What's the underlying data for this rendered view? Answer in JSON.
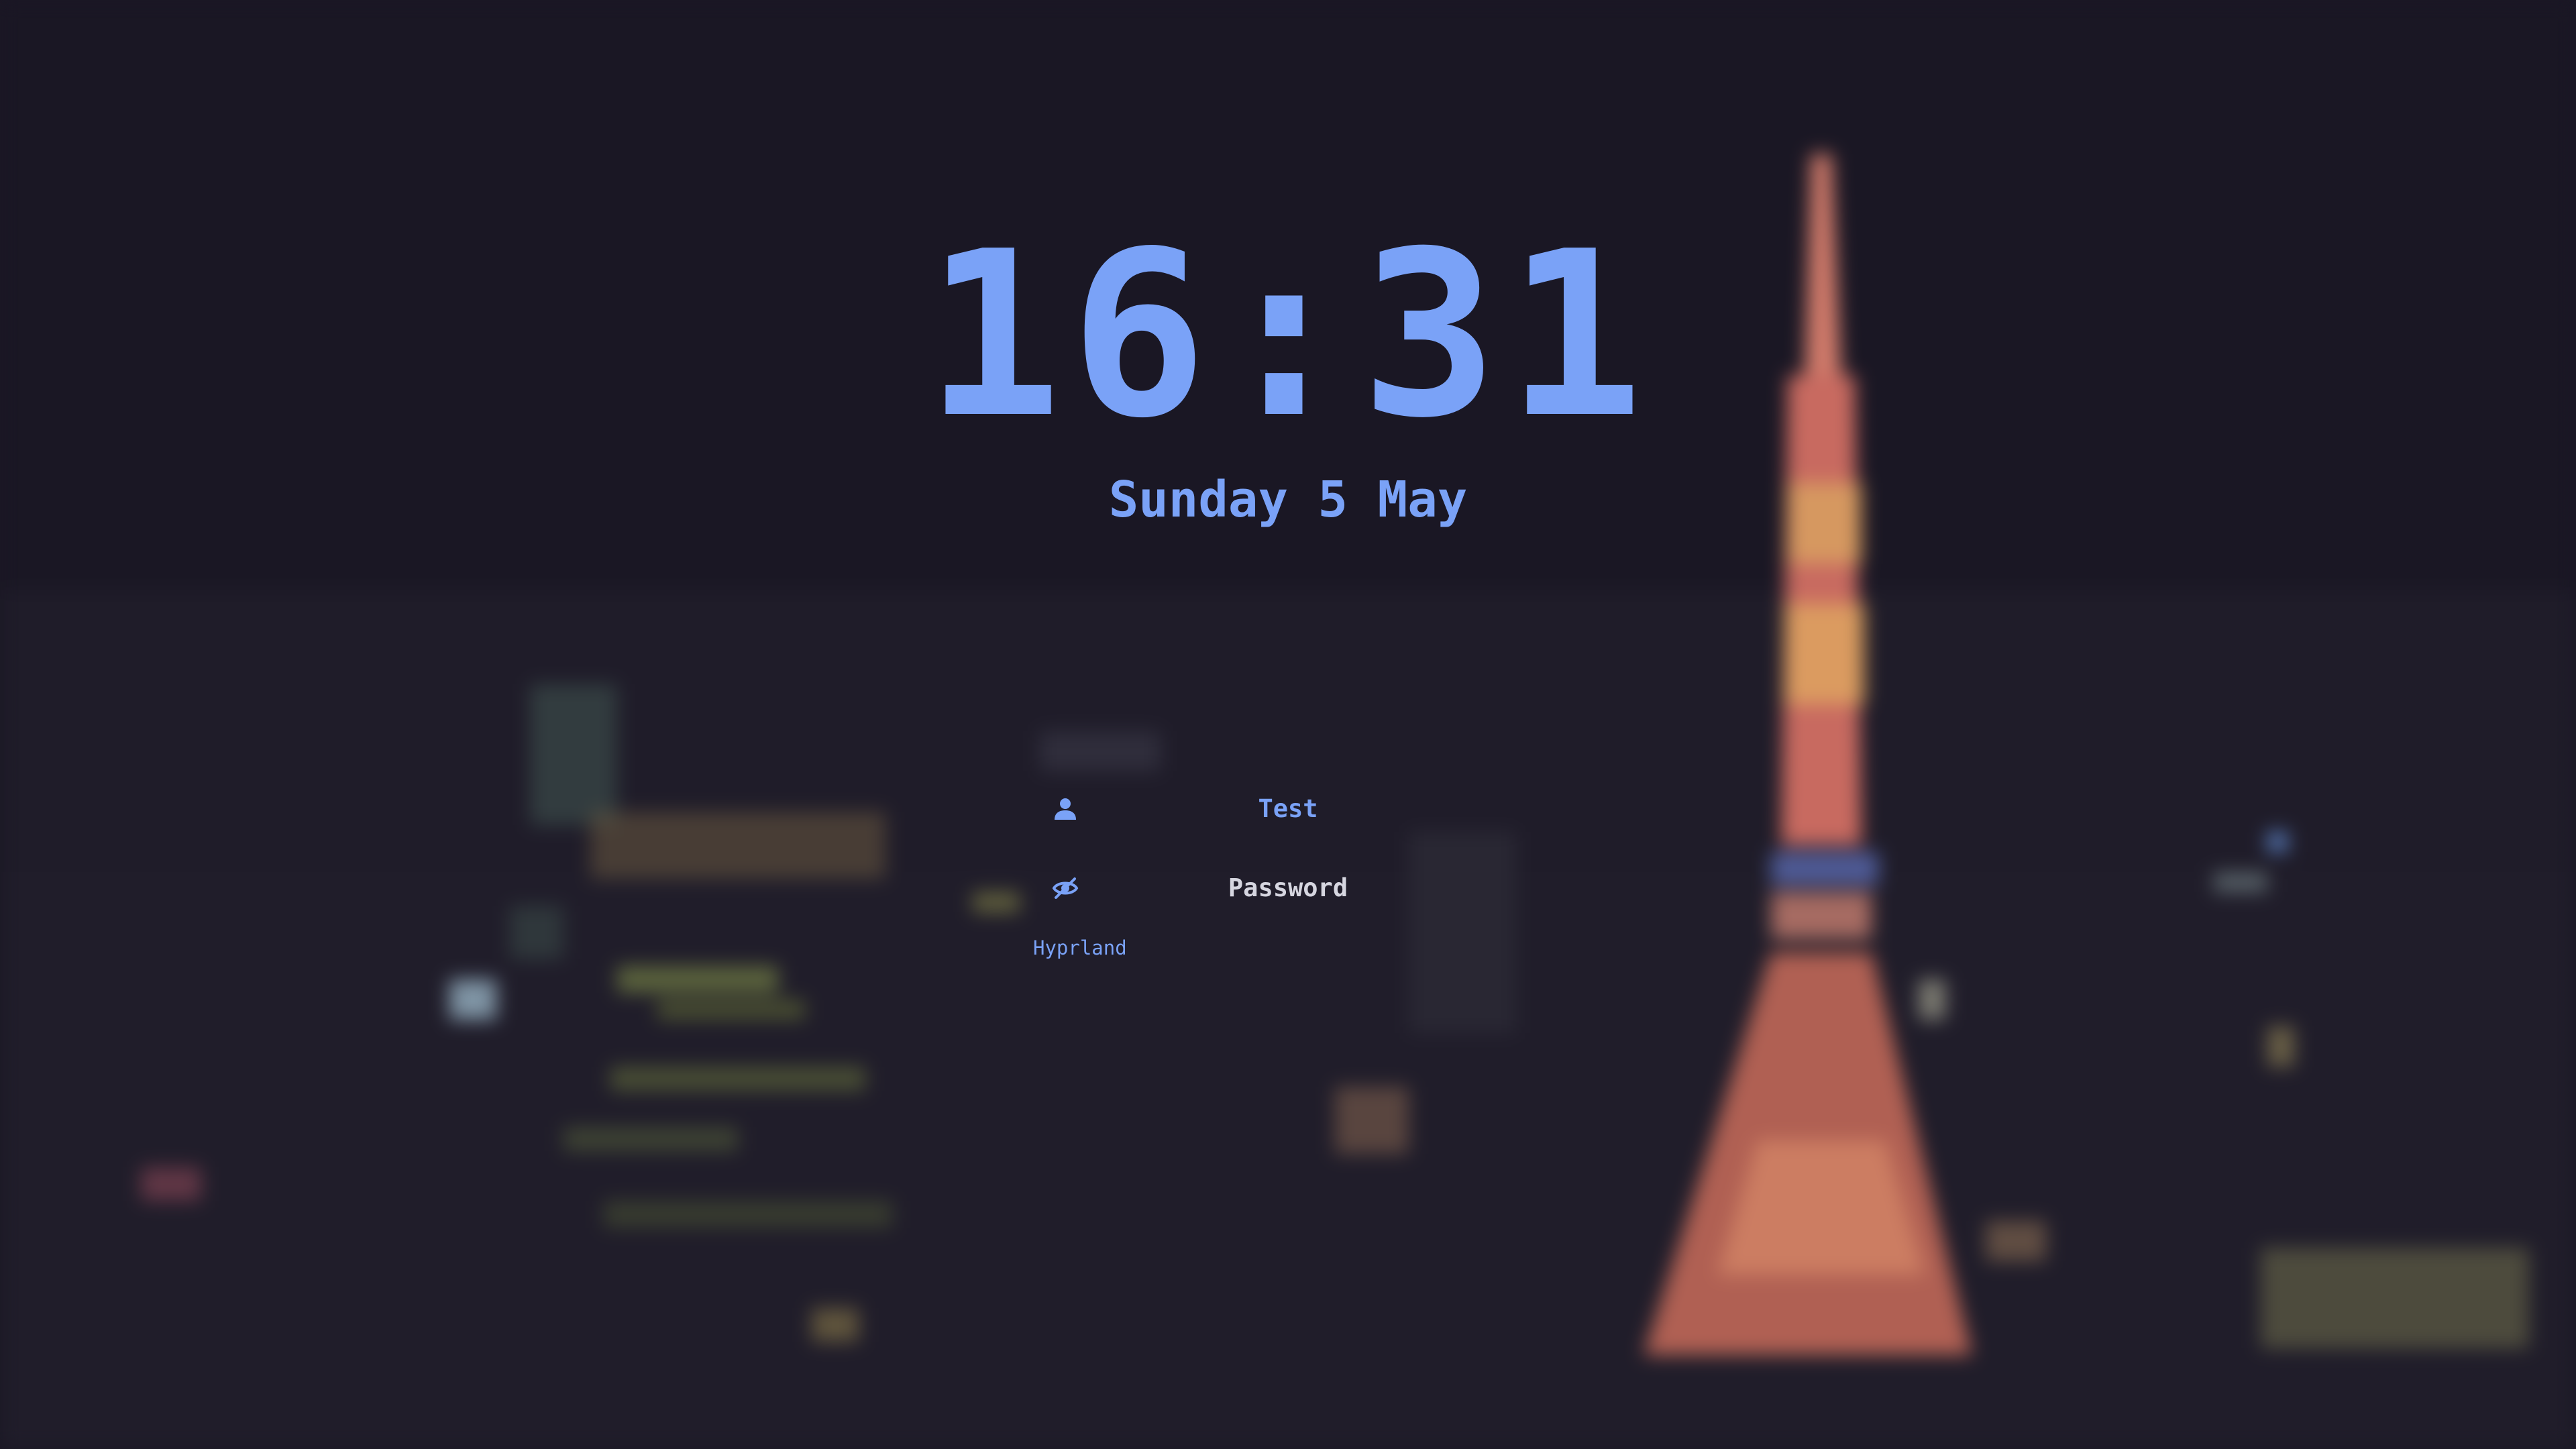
{
  "clock": {
    "time": "16:31",
    "date": "Sunday 5 May"
  },
  "login": {
    "username_value": "Test",
    "password_placeholder": "Password",
    "session_label": "Hyprland",
    "user_icon": "user-icon",
    "password_icon": "eye-slash-icon"
  },
  "colors": {
    "accent": "#7aa2f7",
    "background": "#1a1724",
    "password_text": "#d6d6e0"
  }
}
